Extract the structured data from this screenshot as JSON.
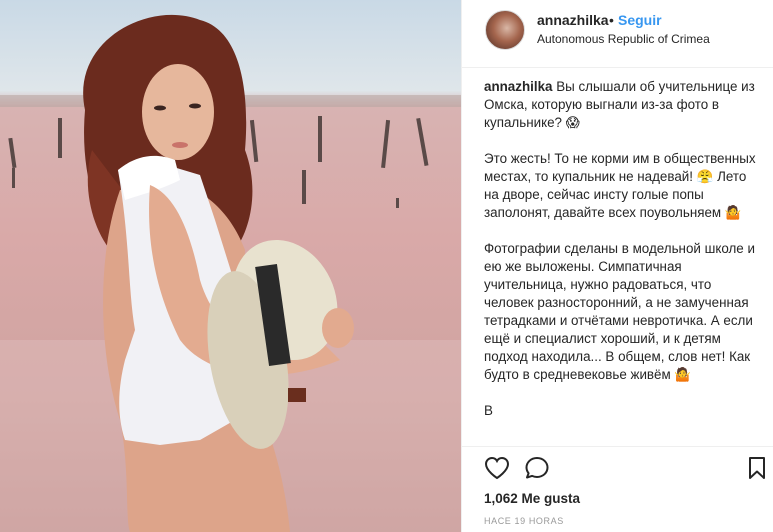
{
  "post": {
    "username": "annazhilka",
    "separator": "•",
    "follow_label": "Seguir",
    "location": "Autonomous Republic of Crimea",
    "caption_user": "annazhilka",
    "caption_text": " Вы слышали об учительнице из Омска, которую выгнали из-за фото в купальнике? 😱\n\nЭто жесть! То не корми им в общественных местах, то купальник не надевай! 😤 Лето на дворе, сейчас инсту голые попы заполонят, давайте всех поувольняем 🤷\n\nФотографии сделаны в модельной школе и ею же выложены. Симпатичная учительница, нужно радоваться, что человек разносторонний, а не замученная тетрадками и отчётами невротичка. А если ещё и специалист хороший, и к детям подход находила... В общем, слов нет! Как будто в средневековье живём 🤷\n\nВ",
    "likes": "1,062 Me gusta",
    "time": "HACE 19 HORAS"
  },
  "icons": {
    "like": "heart-icon",
    "comment": "comment-icon",
    "save": "bookmark-icon"
  },
  "colors": {
    "follow": "#3897f0",
    "text": "#262626",
    "muted": "#999999"
  }
}
